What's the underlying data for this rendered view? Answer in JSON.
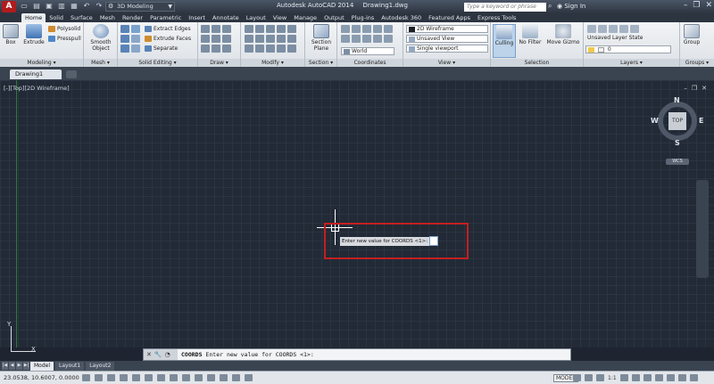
{
  "titlebar": {
    "app_letter": "A",
    "workspace": "3D Modeling",
    "app_name": "Autodesk AutoCAD 2014",
    "file_name": "Drawing1.dwg",
    "search_placeholder": "Type a keyword or phrase",
    "sign_in": "Sign In"
  },
  "ribbon_tabs": [
    "Home",
    "Solid",
    "Surface",
    "Mesh",
    "Render",
    "Parametric",
    "Insert",
    "Annotate",
    "Layout",
    "View",
    "Manage",
    "Output",
    "Plug-ins",
    "Autodesk 360",
    "Featured Apps",
    "Express Tools"
  ],
  "ribbon": {
    "modeling": {
      "title": "Modeling",
      "box": "Box",
      "extrude": "Extrude",
      "polysolid": "Polysolid",
      "presspull": "Presspull"
    },
    "mesh": {
      "title": "Mesh",
      "smooth_object": "Smooth Object"
    },
    "solid_editing": {
      "title": "Solid Editing",
      "extract_edges": "Extract Edges",
      "extrude_faces": "Extrude Faces",
      "separate": "Separate"
    },
    "draw": {
      "title": "Draw"
    },
    "modify": {
      "title": "Modify"
    },
    "section": {
      "title": "Section",
      "section_plane": "Section Plane"
    },
    "coordinates": {
      "title": "Coordinates",
      "world": "World"
    },
    "view": {
      "title": "View",
      "visual_style": "2D Wireframe",
      "saved_view": "Unsaved View",
      "viewport": "Single viewport"
    },
    "selection": {
      "title": "Selection",
      "culling": "Culling",
      "no_filter": "No Filter",
      "move_gizmo": "Move Gizmo"
    },
    "layers": {
      "title": "Layers",
      "layer_state": "Unsaved Layer State",
      "current_layer": "0"
    },
    "groups": {
      "title": "Groups",
      "group": "Group"
    }
  },
  "file_tab": "Drawing1",
  "viewport": {
    "label": "[-][Top][2D Wireframe]",
    "viewcube": {
      "n": "N",
      "s": "S",
      "e": "E",
      "w": "W",
      "face": "TOP"
    },
    "wcs": "WCS",
    "ucs_x": "X",
    "ucs_y": "Y"
  },
  "tooltip": {
    "prompt": "Enter new value for COORDS <1>:",
    "value": ""
  },
  "command_line": {
    "command": "COORDS",
    "prompt": "Enter new value for COORDS <1>:"
  },
  "layout_tabs": [
    "Model",
    "Layout1",
    "Layout2"
  ],
  "statusbar": {
    "coords": "23.0538, 10.6007, 0.0000",
    "model": "MODEL",
    "scale": "1:1"
  },
  "colors": {
    "highlight_border": "#c41f1f",
    "canvas_bg": "#222a36",
    "app_red": "#b01c1c"
  }
}
